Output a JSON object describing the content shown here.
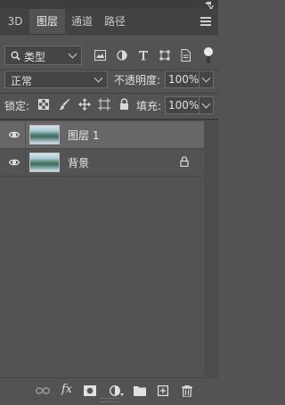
{
  "panel": {
    "collapse_glyph": "◂◂",
    "tabs": [
      {
        "label": "3D",
        "active": false
      },
      {
        "label": "图层",
        "active": true
      },
      {
        "label": "通道",
        "active": false
      },
      {
        "label": "路径",
        "active": false
      }
    ]
  },
  "filter": {
    "kind_label": "类型",
    "icons": [
      "image-filter-icon",
      "adjustment-filter-icon",
      "type-filter-icon",
      "shape-filter-icon",
      "smart-object-filter-icon"
    ]
  },
  "blend": {
    "mode": "正常",
    "opacity_label": "不透明度:",
    "opacity_value": "100%"
  },
  "lock": {
    "label": "锁定:",
    "fill_label": "填充:",
    "fill_value": "100%"
  },
  "layers": [
    {
      "name": "图层 1",
      "visible": true,
      "selected": true,
      "locked": false
    },
    {
      "name": "背景",
      "visible": true,
      "selected": false,
      "locked": true
    }
  ],
  "colors": {
    "panel_bg": "#535353",
    "selected_row": "#676767",
    "tab_bar": "#424242"
  }
}
